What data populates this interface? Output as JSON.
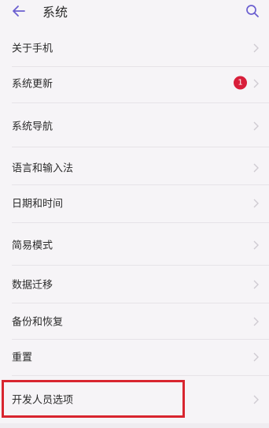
{
  "header": {
    "title": "系统",
    "back_icon": "arrow-left-icon",
    "search_icon": "search-icon"
  },
  "rows": [
    {
      "label": "关于手机"
    },
    {
      "label": "系统更新",
      "badge": "1"
    },
    {
      "label": "系统导航"
    },
    {
      "label": "语言和输入法"
    },
    {
      "label": "日期和时间"
    },
    {
      "label": "简易模式"
    },
    {
      "label": "数据迁移"
    },
    {
      "label": "备份和恢复"
    },
    {
      "label": "重置"
    },
    {
      "label": "开发人员选项"
    }
  ],
  "colors": {
    "accent_icon": "#6b5fd0",
    "badge": "#d81e3a",
    "highlight_box": "#d8252f"
  }
}
